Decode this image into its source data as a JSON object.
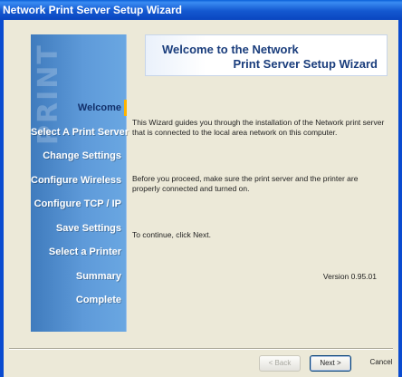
{
  "window": {
    "title": "Network Print Server Setup Wizard"
  },
  "sidebar": {
    "logo_text": "PRINT",
    "steps": [
      {
        "label": "Welcome",
        "active": true
      },
      {
        "label": "Select A Print Server",
        "active": false
      },
      {
        "label": "Change Settings",
        "active": false
      },
      {
        "label": "Configure Wireless",
        "active": false
      },
      {
        "label": "Configure TCP / IP",
        "active": false
      },
      {
        "label": "Save Settings",
        "active": false
      },
      {
        "label": "Select a Printer",
        "active": false
      },
      {
        "label": "Summary",
        "active": false
      },
      {
        "label": "Complete",
        "active": false
      }
    ]
  },
  "main": {
    "banner": {
      "line1": "Welcome to the Network",
      "line2": "Print Server Setup Wizard"
    },
    "paragraph1": "This Wizard guides you through the installation of the Network print server that is connected to the local area network on this computer.",
    "paragraph2": "Before you proceed, make sure the print server and the printer are properly connected and turned on.",
    "paragraph3": "To continue, click Next.",
    "version": "Version 0.95.01"
  },
  "footer": {
    "back_label": "< Back",
    "next_label": "Next >",
    "cancel_label": "Cancel"
  },
  "colors": {
    "title_bar": "#0a46c0",
    "side_panel": "#5e9ad9",
    "active_step": "#12306b"
  }
}
